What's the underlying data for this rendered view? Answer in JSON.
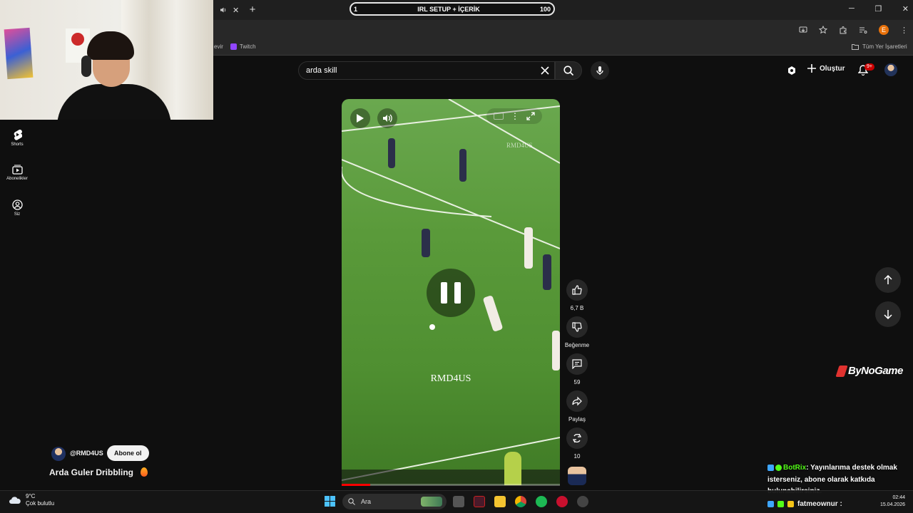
{
  "browser": {
    "overlay_left": "1",
    "overlay_title": "IRL SETUP + İÇERİK",
    "overlay_right": "100",
    "bookmarks_left": "evir",
    "bookmark_twitch": "Twitch",
    "bookmarks_all": "Tüm Yer İşaretleri",
    "profile_letter": "E"
  },
  "search": {
    "query": "arda skill"
  },
  "header": {
    "create_label": "Oluştur",
    "notifications_badge": "9+"
  },
  "sidebar": {
    "items": [
      {
        "label": "Shorts",
        "icon": "shorts-icon"
      },
      {
        "label": "Abonelikler",
        "icon": "subscriptions-icon"
      },
      {
        "label": "Siz",
        "icon": "you-icon"
      }
    ]
  },
  "video": {
    "watermark": "RMD4US",
    "watermark_top": "RMD4US",
    "progress_fraction": 0.13
  },
  "actions": {
    "like_count": "6,7 B",
    "dislike_label": "Beğenme",
    "comment_count": "59",
    "share_label": "Paylaş",
    "remix_count": "10"
  },
  "channel": {
    "handle": "@RMD4US",
    "subscribe_label": "Abone ol",
    "title": "Arda Guler Dribbling"
  },
  "sponsor": {
    "name": "ByNoGame"
  },
  "chat": {
    "bot_name": "BotRix",
    "bot_message": ": Yayınlarıma destek olmak isterseniz, abone olarak katkıda bulunabilirsiniz.",
    "user2": "fatmeownur :"
  },
  "taskbar": {
    "weather_temp": "9°C",
    "weather_desc": "Çok bulutlu",
    "search_placeholder": "Ara",
    "time": "02:44",
    "date": "15.04.2026"
  }
}
